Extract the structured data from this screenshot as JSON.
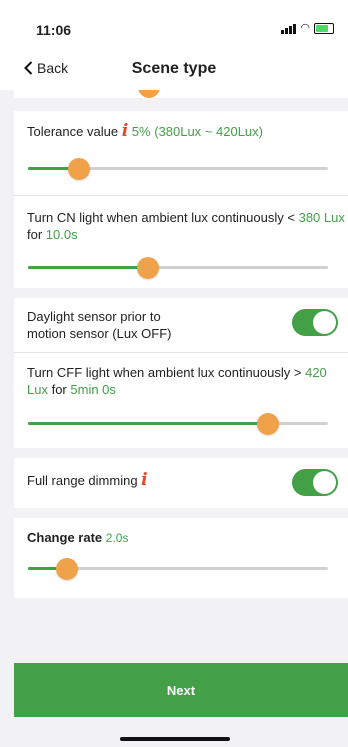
{
  "status_bar": {
    "time": "11:06"
  },
  "nav": {
    "back_label": "Back",
    "title": "Scene type"
  },
  "tolerance": {
    "label": "Tolerance value",
    "percent": "5%",
    "range": "(380Lux ~ 420Lux)",
    "value_fraction": 0.17
  },
  "on_light": {
    "text_prefix": "Turn CN light when ambient lux continuously <",
    "lux_value": "380",
    "unit": "Lux",
    "for_word": "for",
    "duration": "10.0s",
    "value_fraction": 0.4
  },
  "daylight": {
    "label_line1": "Daylight sensor prior to",
    "label_line2": "motion sensor (Lux OFF)",
    "enabled": true
  },
  "off_light": {
    "text_prefix": "Turn CFF light when ambient lux continuously >",
    "lux_value": "420",
    "unit": "Lux",
    "for_word": "for",
    "duration": "5min 0s",
    "value_fraction": 0.8
  },
  "full_range": {
    "label": "Full range dimming",
    "enabled": true
  },
  "change_rate": {
    "label": "Change rate",
    "value": "2.0s",
    "value_fraction": 0.13
  },
  "next_button": {
    "label": "Next"
  },
  "colors": {
    "accent": "#43a047",
    "thumb": "#f0a24a",
    "info": "#e14a2c"
  }
}
